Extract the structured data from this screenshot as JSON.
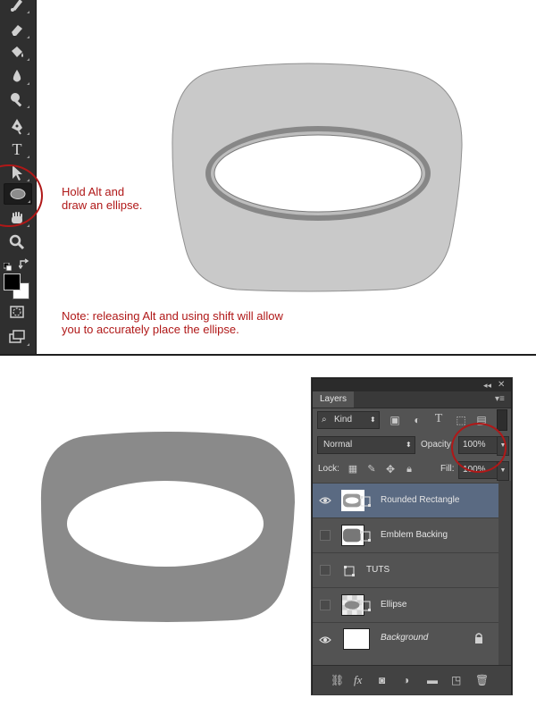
{
  "colors": {
    "annotation_red": "#b01818",
    "outer_shape_fill": "#c9c9c9",
    "ring_fill": "#878787",
    "emblem_fill": "#8a8a8a",
    "selected_layer": "#5a6a82",
    "foreground_color": "#000000",
    "background_color": "#ffffff"
  },
  "toolbar": {
    "tools": [
      {
        "name": "spot-healing-brush-icon"
      },
      {
        "name": "eraser-icon"
      },
      {
        "name": "paint-bucket-icon"
      },
      {
        "name": "blur-icon"
      },
      {
        "name": "dodge-icon"
      },
      {
        "name": "pen-icon"
      },
      {
        "name": "type-icon",
        "glyph": "T"
      },
      {
        "name": "path-selection-icon"
      },
      {
        "name": "ellipse-tool-icon",
        "active": true
      },
      {
        "name": "hand-icon"
      },
      {
        "name": "zoom-icon"
      },
      {
        "name": "quick-mask-icon"
      },
      {
        "name": "screen-mode-icon"
      }
    ]
  },
  "annotations": {
    "hold_alt": "Hold Alt and\ndraw an ellipse.",
    "note": "Note: releasing Alt and using shift will allow\nyou to accurately place the ellipse."
  },
  "layers_panel": {
    "tab_label": "Layers",
    "filter_kind_label": "Kind",
    "blend_mode": "Normal",
    "opacity_label": "Opacity:",
    "opacity_value": "100%",
    "lock_label": "Lock:",
    "fill_label": "Fill:",
    "fill_value": "100%",
    "layers": [
      {
        "name": "Rounded Rectangle",
        "visible": true,
        "selected": true
      },
      {
        "name": "Emblem Backing",
        "visible": false,
        "selected": false
      },
      {
        "name": "TUTS",
        "visible": false,
        "selected": false
      },
      {
        "name": "Ellipse",
        "visible": false,
        "selected": false
      },
      {
        "name": "Background",
        "visible": true,
        "selected": false,
        "locked": true
      }
    ],
    "bottom_icons": [
      "link-icon",
      "fx-icon",
      "add-mask-icon",
      "adjustment-layer-icon",
      "new-group-icon",
      "new-layer-icon",
      "delete-icon"
    ],
    "fx_glyph": "fx"
  }
}
